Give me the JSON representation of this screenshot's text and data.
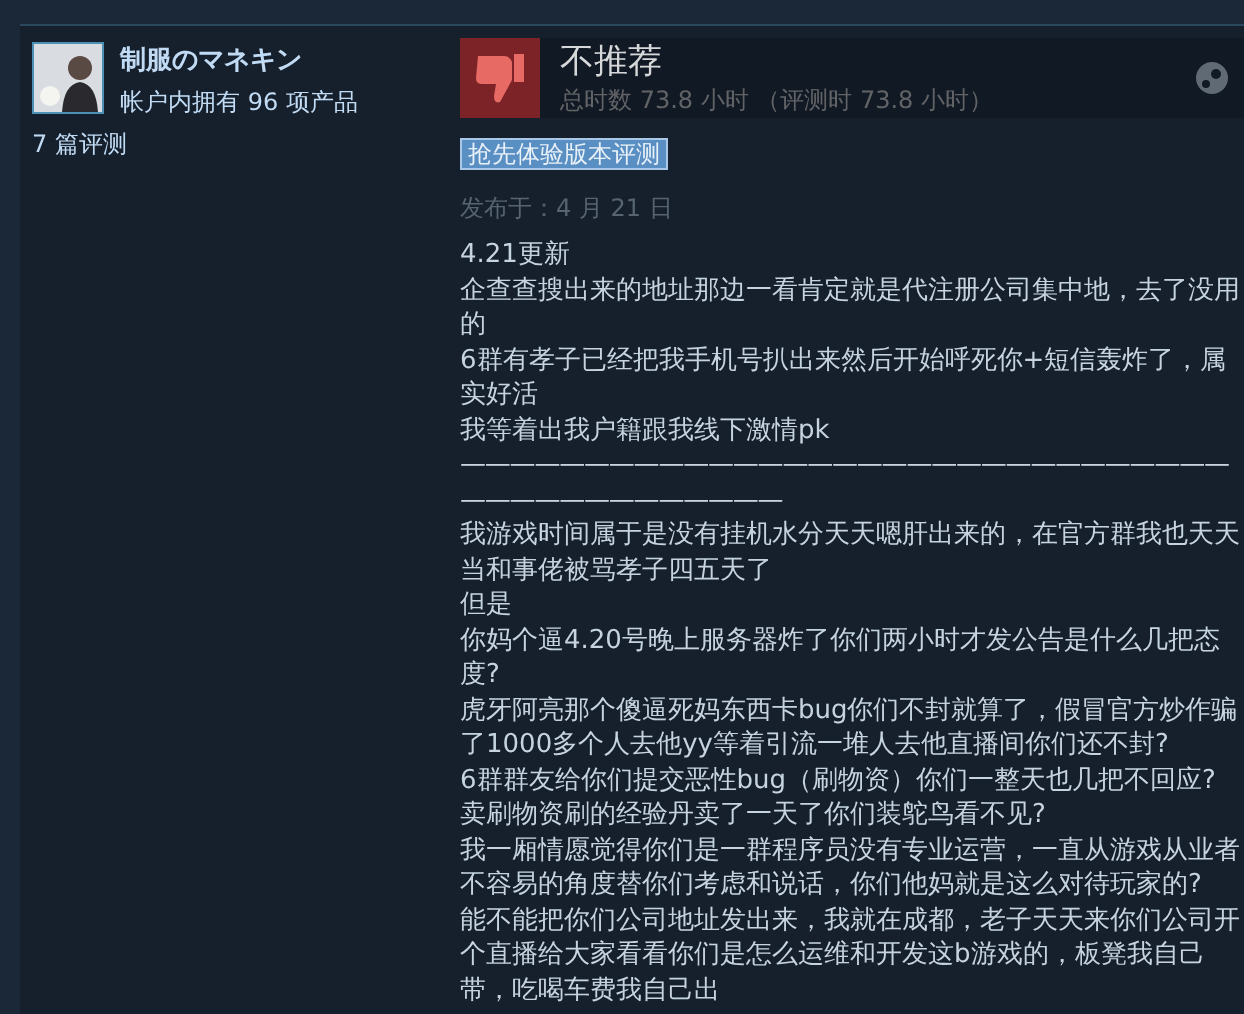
{
  "reviewer": {
    "name": "制服のマネキン",
    "products": "帐户内拥有 96 项产品",
    "reviews": "7 篇评测"
  },
  "review": {
    "recommended": false,
    "verdict": "不推荐",
    "hours": "总时数 73.8 小时  （评测时 73.8 小时）",
    "badge": "抢先体验版本评测",
    "posted": "发布于：4 月 21 日",
    "body_lines": [
      "4.21更新",
      "企查查搜出来的地址那边一看肯定就是代注册公司集中地，去了没用的",
      "6群有孝子已经把我手机号扒出来然后开始呼死你+短信轰炸了，属实好活",
      "我等着出我户籍跟我线下激情pk",
      {
        "kind": "divider",
        "text": "————————————————————————————————————————————"
      },
      "我游戏时间属于是没有挂机水分天天嗯肝出来的，在官方群我也天天当和事佬被骂孝子四五天了",
      "但是",
      "你妈个逼4.20号晚上服务器炸了你们两小时才发公告是什么几把态度?",
      "虎牙阿亮那个傻逼死妈东西卡bug你们不封就算了，假冒官方炒作骗了1000多个人去他yy等着引流一堆人去他直播间你们还不封?",
      "6群群友给你们提交恶性bug（刷物资）你们一整天也几把不回应?",
      "卖刷物资刷的经验丹卖了一天了你们装鸵鸟看不见?",
      "我一厢情愿觉得你们是一群程序员没有专业运营，一直从游戏从业者不容易的角度替你们考虑和说话，你们他妈就是这么对待玩家的?",
      "能不能把你们公司地址发出来，我就在成都，老子天天来你们公司开个直播给大家看看你们是怎么运维和开发这b游戏的，板凳我自己带，吃喝车费我自己出"
    ]
  }
}
